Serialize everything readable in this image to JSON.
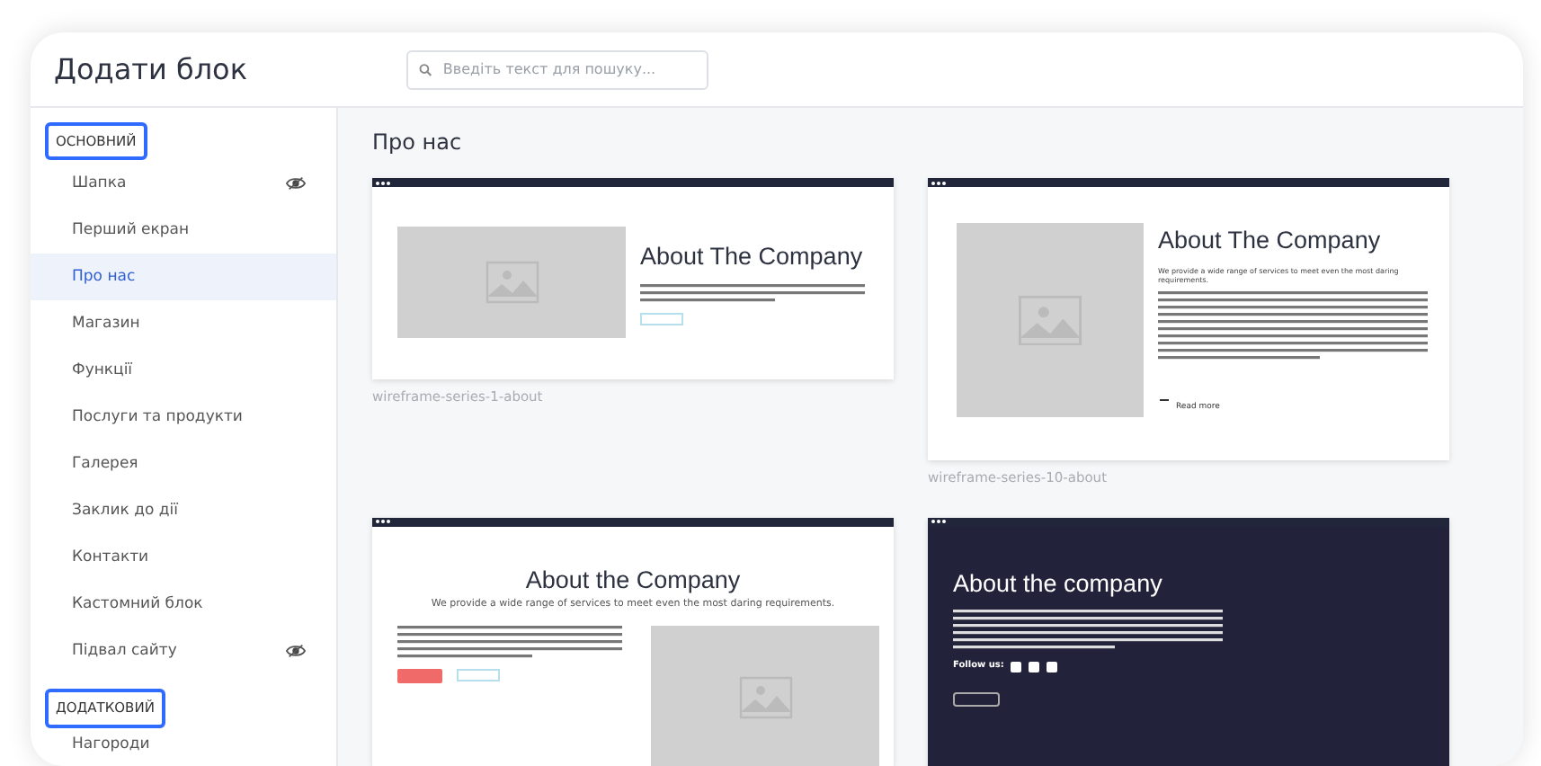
{
  "panel": {
    "title": "Додати блок",
    "search": {
      "placeholder": "Введіть текст для пошуку..."
    }
  },
  "sidebar": {
    "sections": [
      {
        "label": "ОСНОВНИЙ",
        "items": [
          {
            "label": "Шапка",
            "selected": false,
            "eye_icon": true
          },
          {
            "label": "Перший екран",
            "selected": false,
            "eye_icon": false
          },
          {
            "label": "Про нас",
            "selected": true,
            "eye_icon": false
          },
          {
            "label": "Магазин",
            "selected": false,
            "eye_icon": false
          },
          {
            "label": "Функції",
            "selected": false,
            "eye_icon": false
          },
          {
            "label": "Послуги та продукти",
            "selected": false,
            "eye_icon": false
          },
          {
            "label": "Галерея",
            "selected": false,
            "eye_icon": false
          },
          {
            "label": "Заклик до дії",
            "selected": false,
            "eye_icon": false
          },
          {
            "label": "Контакти",
            "selected": false,
            "eye_icon": false
          },
          {
            "label": "Кастомний блок",
            "selected": false,
            "eye_icon": false
          },
          {
            "label": "Підвал сайту",
            "selected": false,
            "eye_icon": true
          }
        ]
      },
      {
        "label": "ДОДАТКОВИЙ",
        "items": [
          {
            "label": "Нагороди",
            "selected": false,
            "eye_icon": false
          }
        ]
      }
    ]
  },
  "content": {
    "heading": "Про нас",
    "templates": [
      {
        "kind": "image-left",
        "heading": "About The Company",
        "caption": "wireframe-series-1-about"
      },
      {
        "kind": "image-left-long",
        "heading": "About The Company",
        "intro": "We provide a wide range of services to meet even the most daring requirements.",
        "link": "Read more",
        "caption": "wireframe-series-10-about"
      },
      {
        "kind": "centered",
        "heading": "About the Company",
        "subtitle": "We provide a wide range of services to meet even the most daring requirements."
      },
      {
        "kind": "dark",
        "heading": "About the company",
        "follow": "Follow us:"
      }
    ]
  }
}
